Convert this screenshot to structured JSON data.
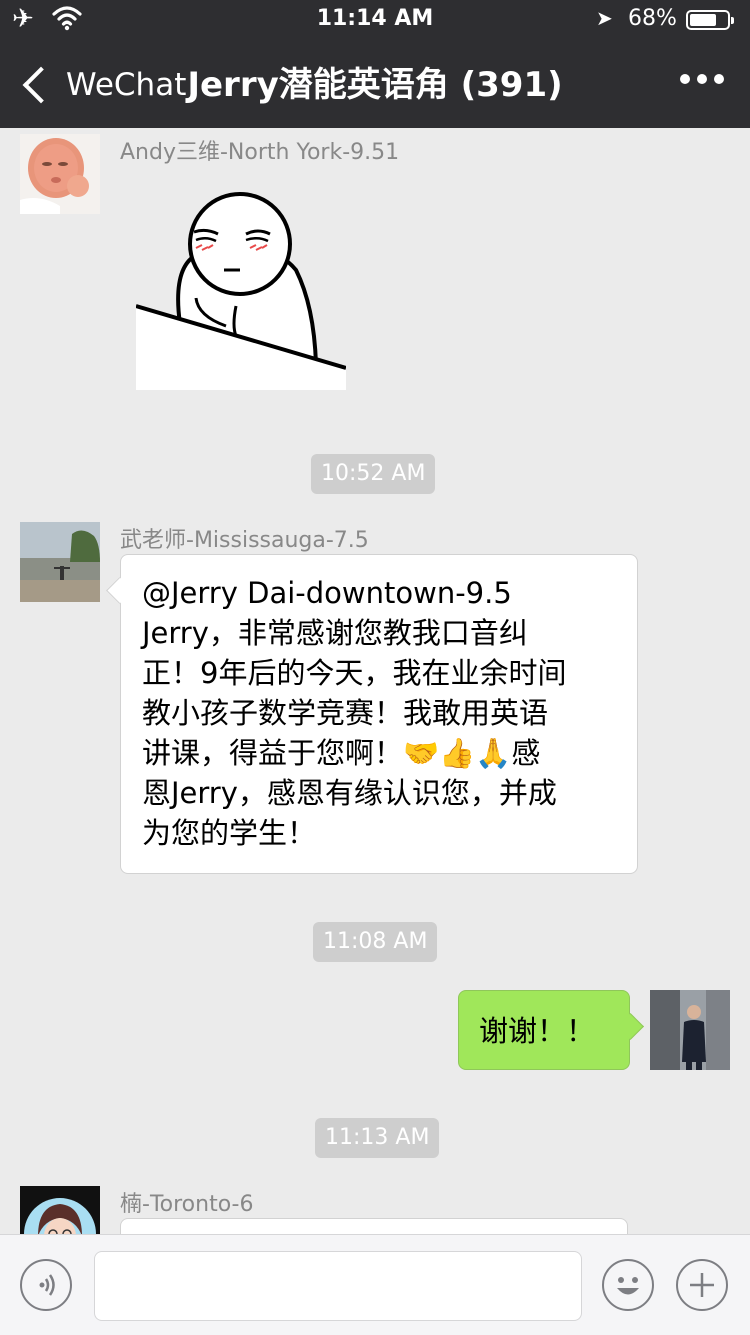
{
  "status_bar": {
    "time": "11:14 AM",
    "battery": "68%"
  },
  "nav": {
    "back_label": "WeChat",
    "title": "Jerry潜能英语角 (391)"
  },
  "messages": [
    {
      "sender": "Andy三维-North York-9.51",
      "type": "sticker"
    },
    {
      "timestamp": "10:52 AM"
    },
    {
      "sender": "武老师-Mississauga-7.5",
      "lines": [
        "@Jerry Dai-downtown-9.5",
        "Jerry，非常感谢您教我口音纠",
        "正！9年后的今天，我在业余时间",
        "教小孩子数学竞赛！我敢用英语",
        "讲课，得益于您啊！🤝👍🙏感",
        "恩Jerry，感恩有缘认识您，并成",
        "为您的学生！"
      ]
    },
    {
      "timestamp": "11:08 AM"
    },
    {
      "own": true,
      "text": "谢谢！！"
    },
    {
      "timestamp": "11:13 AM"
    },
    {
      "sender": "楠-Toronto-6"
    }
  ],
  "input": {
    "value": ""
  },
  "colors": {
    "header": "#2e2e31",
    "background": "#ebebeb",
    "own_bubble": "#a0e75a",
    "timestamp_bg": "#cecece"
  },
  "icons": [
    "airplane-icon",
    "wifi-icon",
    "location-arrow-icon",
    "battery-icon",
    "back-chevron-icon",
    "more-icon",
    "voice-icon",
    "emoji-icon",
    "plus-icon"
  ]
}
